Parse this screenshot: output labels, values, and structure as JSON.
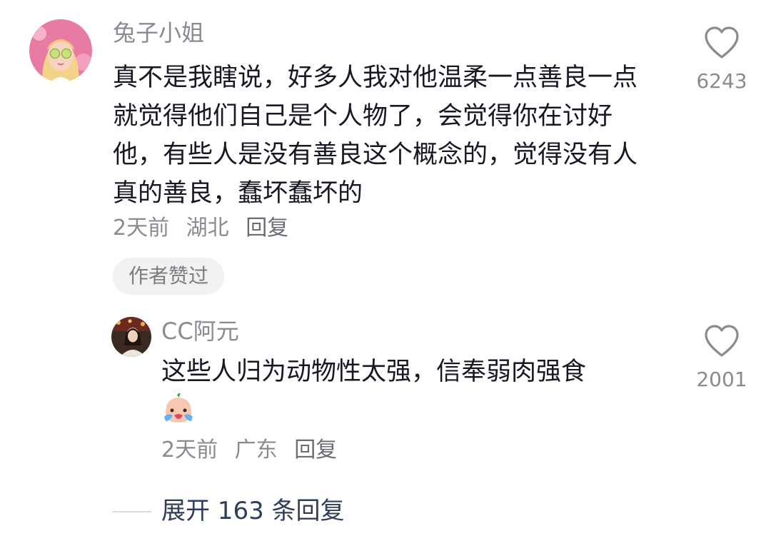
{
  "comment": {
    "username": "兔子小姐",
    "text": "真不是我瞎说，好多人我对他温柔一点善良一点就觉得他们自己是个人物了，会觉得你在讨好他，有些人是没有善良这个概念的，觉得没有人真的善良，蠢坏蠢坏的",
    "time": "2天前",
    "location": "湖北",
    "reply_label": "回复",
    "author_liked_badge": "作者赞过",
    "like_count": "6243",
    "like_icon": "heart-outline-icon"
  },
  "reply": {
    "username": "CC阿元",
    "text": "这些人归为动物性太强，信奉弱肉强食",
    "emoji": "crying-face-emoji",
    "time": "2天前",
    "location": "广东",
    "reply_label": "回复",
    "like_count": "2001",
    "like_icon": "heart-outline-icon"
  },
  "expand": {
    "label": "展开 163 条回复"
  },
  "colors": {
    "text_primary": "#161823",
    "text_secondary": "#8a8b91",
    "badge_bg": "#f1f1f2",
    "expand_text": "#2f3e5c"
  }
}
